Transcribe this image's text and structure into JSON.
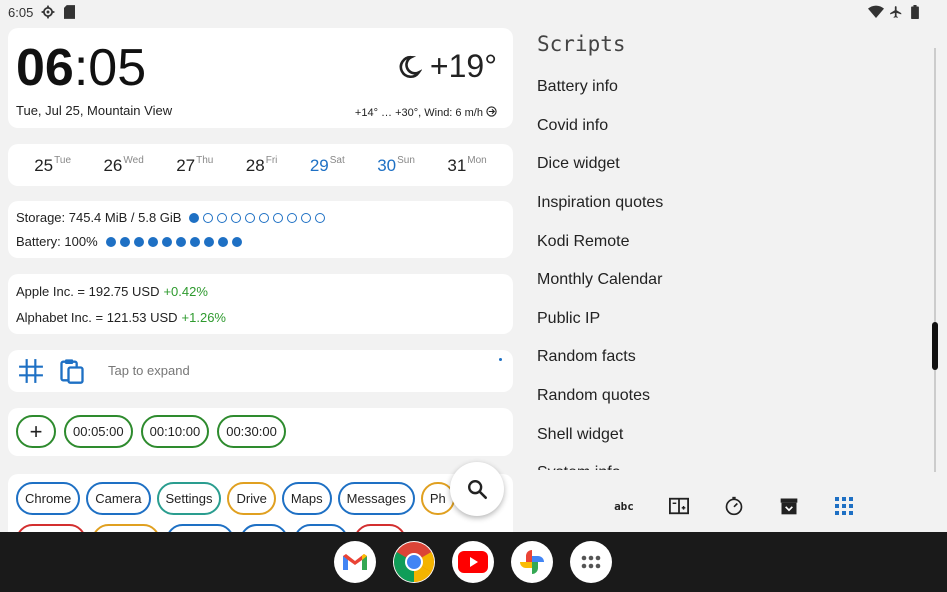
{
  "status_bar": {
    "time": "6:05",
    "left_icons": [
      "settings-icon",
      "sd-card-icon"
    ],
    "right_icons": [
      "wifi-icon",
      "airplane-icon",
      "battery-icon"
    ]
  },
  "clock": {
    "hours": "06",
    "separator": ":",
    "minutes": "05",
    "date_location": "Tue, Jul 25, Mountain View",
    "weather_icon": "moon-icon",
    "temperature": "+19°",
    "forecast": "+14° … +30°, Wind: 6 m/h"
  },
  "week": [
    {
      "num": "25",
      "abbr": "Tue",
      "weekend": false
    },
    {
      "num": "26",
      "abbr": "Wed",
      "weekend": false
    },
    {
      "num": "27",
      "abbr": "Thu",
      "weekend": false
    },
    {
      "num": "28",
      "abbr": "Fri",
      "weekend": false
    },
    {
      "num": "29",
      "abbr": "Sat",
      "weekend": true
    },
    {
      "num": "30",
      "abbr": "Sun",
      "weekend": true
    },
    {
      "num": "31",
      "abbr": "Mon",
      "weekend": false
    }
  ],
  "system": {
    "storage_label": "Storage: 745.4 MiB / 5.8 GiB",
    "storage_level_dots": 1,
    "total_dots": 10,
    "battery_label": "Battery: 100%",
    "battery_level_dots": 10
  },
  "stocks": [
    {
      "text": "Apple Inc. = 192.75 USD",
      "change": "+0.42%"
    },
    {
      "text": "Alphabet Inc. = 121.53 USD",
      "change": "+1.26%"
    }
  ],
  "notes": {
    "placeholder": "Tap to expand"
  },
  "timers": {
    "add_label": "+",
    "items": [
      "00:05:00",
      "00:10:00",
      "00:30:00"
    ]
  },
  "apps": {
    "row1": [
      {
        "label": "Chrome",
        "color": "#1e70c4"
      },
      {
        "label": "Camera",
        "color": "#1e70c4"
      },
      {
        "label": "Settings",
        "color": "#2a9d8f"
      },
      {
        "label": "Drive",
        "color": "#e0a020"
      },
      {
        "label": "Maps",
        "color": "#1e70c4"
      },
      {
        "label": "Messages",
        "color": "#1e70c4"
      },
      {
        "label": "Ph",
        "color": "#e0a020"
      }
    ],
    "row2_colors": [
      "#d32f2f",
      "#e0a020",
      "#1e70c4",
      "#1e70c4",
      "#1e70c4",
      "#d32f2f"
    ]
  },
  "scripts": {
    "title": "Scripts",
    "items": [
      "Battery info",
      "Covid info",
      "Dice widget",
      "Inspiration quotes",
      "Kodi Remote",
      "Monthly Calendar",
      "Public IP",
      "Random facts",
      "Random quotes",
      "Shell widget",
      "System info"
    ],
    "tabs": [
      "abc",
      "calculator-icon",
      "timer-icon",
      "archive-icon",
      "apps-grid-icon"
    ],
    "abc_label": "abc"
  },
  "dock": [
    "gmail-icon",
    "chrome-icon",
    "youtube-icon",
    "photos-icon",
    "app-drawer-icon"
  ],
  "colors": {
    "accent": "#1e70c4",
    "positive": "#2e9a2e",
    "timer_border": "#2e8b2e"
  }
}
